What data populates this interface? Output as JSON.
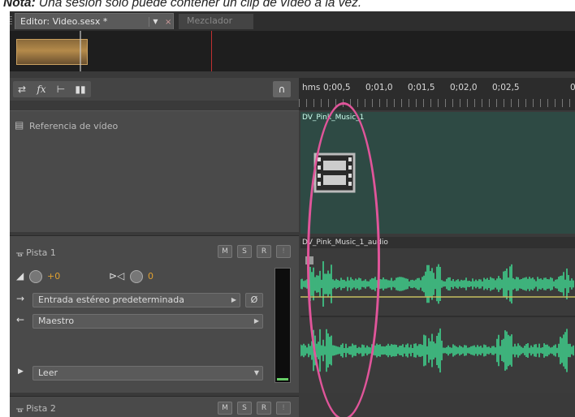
{
  "caption": {
    "bold": "Nota:",
    "text": "Una sesión sólo puede contener un clip de vídeo a la vez."
  },
  "tabs": {
    "editor": "Editor: Video.sesx *",
    "mixer": "Mezclador"
  },
  "ruler": {
    "unit": "hms",
    "ticks": [
      "0;00,5",
      "0;01,0",
      "0;01,5",
      "0;02,0",
      "0;02,5",
      "0"
    ]
  },
  "video_track": {
    "label": "Referencia de vídeo",
    "clip_name": "DV_Pink_Music_1"
  },
  "track1": {
    "name": "Pista 1",
    "buttons": [
      "M",
      "S",
      "R"
    ],
    "volume": "+0",
    "pan": "0",
    "input": "Entrada estéreo predeterminada",
    "output": "Maestro",
    "automation": "Leer",
    "clip_name": "DV_Pink_Music_1_audio"
  },
  "track2": {
    "name": "Pista 2",
    "buttons": [
      "M",
      "S",
      "R"
    ]
  },
  "colors": {
    "waveform": "#3fd08c",
    "annotation": "#e0559a",
    "video_clip": "#2e4a44"
  }
}
